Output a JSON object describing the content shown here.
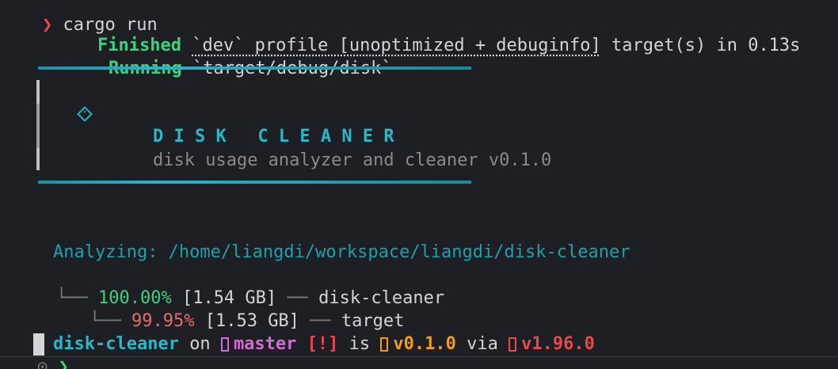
{
  "colors": {
    "background": "#1e1f24",
    "text": "#d4d4d4",
    "status_green": "#3fd17d",
    "accent_cyan": "#26b2c4",
    "warning_red": "#e84a4a",
    "version_orange": "#f29b1d",
    "branch_magenta": "#d46ad4"
  },
  "command": {
    "prompt_symbol": "❯",
    "text": "cargo run"
  },
  "build": {
    "finished_label": "Finished",
    "profile_text": "`dev` profile [unoptimized + debuginfo]",
    "finished_rest": " target(s) in 0.13s",
    "running_label": "Running",
    "running_path": "`target/debug/disk`"
  },
  "banner": {
    "title": "D I S K   C L E A N E R",
    "subtitle": "disk usage analyzer and cleaner v0.1.0"
  },
  "analysis": {
    "line": "Analyzing: /home/liangdi/workspace/liangdi/disk-cleaner",
    "tree": [
      {
        "branch": "└──",
        "percent": "100.00%",
        "size": "[1.54 GB]",
        "sep": "──",
        "name": "disk-cleaner"
      },
      {
        "branch": "└──",
        "percent": "99.95%",
        "size": "[1.53 GB]",
        "sep": "──",
        "name": "target"
      }
    ]
  },
  "status_line": {
    "dir": "disk-cleaner",
    "on": "on",
    "branch": "master",
    "flags": "[!]",
    "is": "is",
    "pkg_version": "v0.1.0",
    "via": "via",
    "rust_version": "v1.96.0"
  },
  "prompt": {
    "left_mark": "⊙",
    "symbol": "❯"
  }
}
